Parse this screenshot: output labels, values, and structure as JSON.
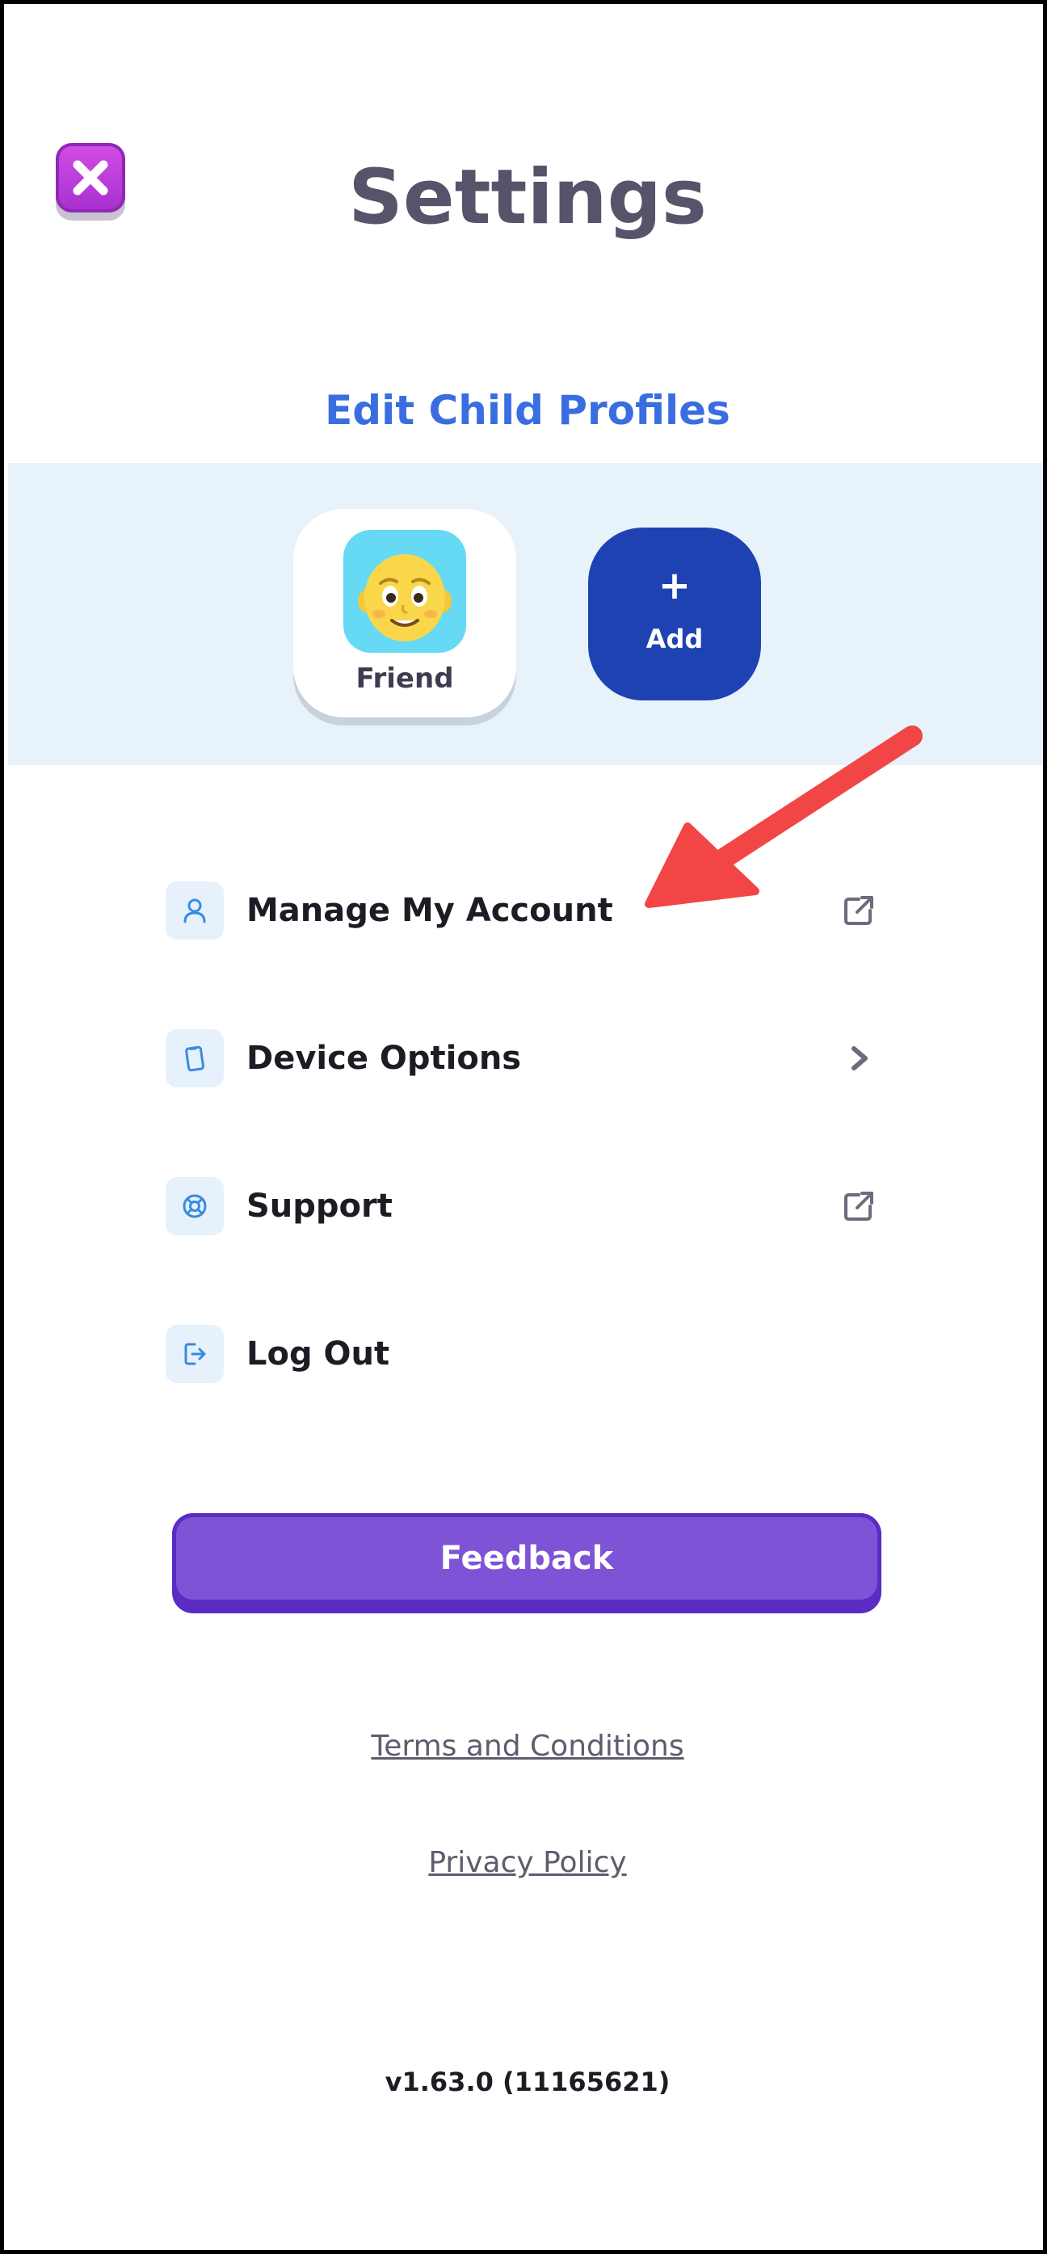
{
  "header": {
    "title": "Settings",
    "close_icon": "close-x-icon"
  },
  "profiles": {
    "edit_link": "Edit Child Profiles",
    "items": [
      {
        "name": "Friend",
        "avatar_icon": "cartoon-face-avatar"
      }
    ],
    "add_button": {
      "plus": "+",
      "label": "Add"
    }
  },
  "menu": {
    "items": [
      {
        "label": "Manage My Account",
        "icon": "user-icon",
        "trailing_icon": "external-link-icon"
      },
      {
        "label": "Device Options",
        "icon": "device-icon",
        "trailing_icon": "chevron-right-icon"
      },
      {
        "label": "Support",
        "icon": "lifebuoy-icon",
        "trailing_icon": "external-link-icon"
      },
      {
        "label": "Log Out",
        "icon": "logout-icon",
        "trailing_icon": ""
      }
    ]
  },
  "feedback": {
    "label": "Feedback"
  },
  "footer": {
    "terms": "Terms and Conditions",
    "privacy": "Privacy Policy",
    "version": "v1.63.0 (11165621)"
  },
  "colors": {
    "title": "#55546a",
    "link_blue": "#3a6ee0",
    "band_bg": "#e8f2fb",
    "add_button": "#1f42b3",
    "feedback_button": "#7e53d6",
    "close_button": "#c23ddc",
    "annotation_arrow": "#f24646"
  }
}
